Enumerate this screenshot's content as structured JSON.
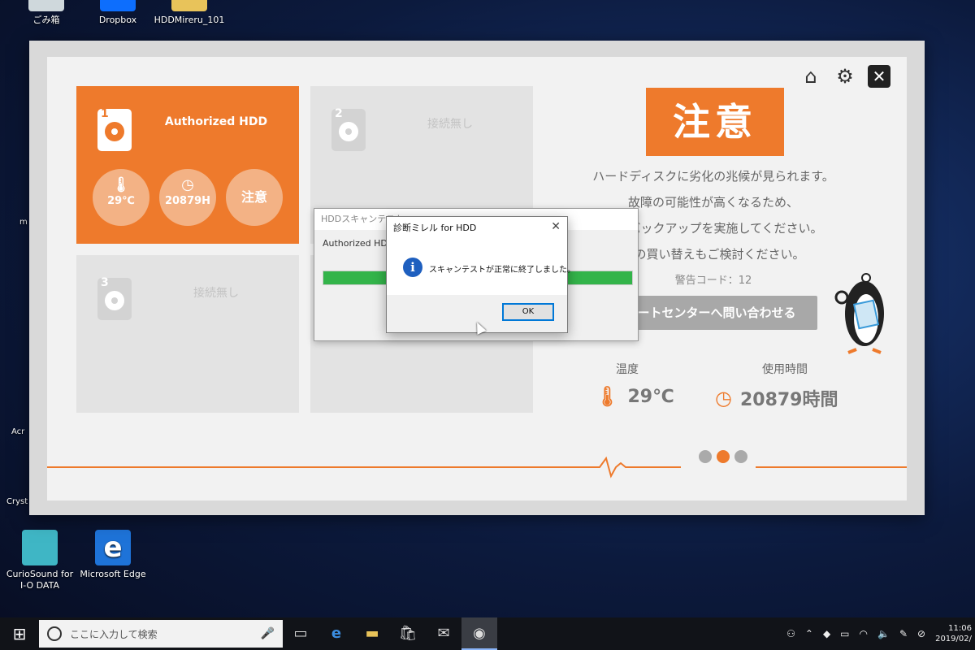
{
  "desktop": {
    "icons": [
      {
        "name": "recycle-bin",
        "label": "ごみ箱"
      },
      {
        "name": "dropbox",
        "label": "Dropbox"
      },
      {
        "name": "hddmireru",
        "label": "HDDMireru_101"
      },
      {
        "name": "curiosound",
        "label": "CurioSound for I-O DATA"
      },
      {
        "name": "edge",
        "label": "Microsoft Edge"
      }
    ],
    "edge_labels": {
      "a": "m",
      "b": "Acr",
      "c": "Cryst"
    }
  },
  "app": {
    "slots": [
      {
        "num": "1",
        "title": "Authorized HDD",
        "temp": "29℃",
        "hours": "20879H",
        "status": "注意"
      },
      {
        "num": "2",
        "title": "接続無し"
      },
      {
        "num": "3",
        "title": "接続無し"
      }
    ],
    "warning_title": "注意",
    "messages": [
      "ハードディスクに劣化の兆候が見られます。",
      "故障の可能性が高くなるため、",
      "的なバックアップを実施してください。",
      "品の買い替えもご検討ください。"
    ],
    "warning_code": "警告コード：12",
    "support_button": "ートセンターへ問い合わせる",
    "temp_label": "温度",
    "temp_value": "29℃",
    "usage_label": "使用時間",
    "usage_value": "20879時間",
    "accent": "#ee7a2c"
  },
  "scan_dialog": {
    "title": "HDDスキャンテスト",
    "text": "Authorized HDD を",
    "progress": 1.0,
    "color": "#33b44a"
  },
  "message_box": {
    "title": "診断ミレル for HDD",
    "text": "スキャンテストが正常に終了しました。",
    "ok": "OK"
  },
  "taskbar": {
    "search_placeholder": "ここに入力して検索",
    "time": "11:06",
    "date": "2019/02/"
  }
}
